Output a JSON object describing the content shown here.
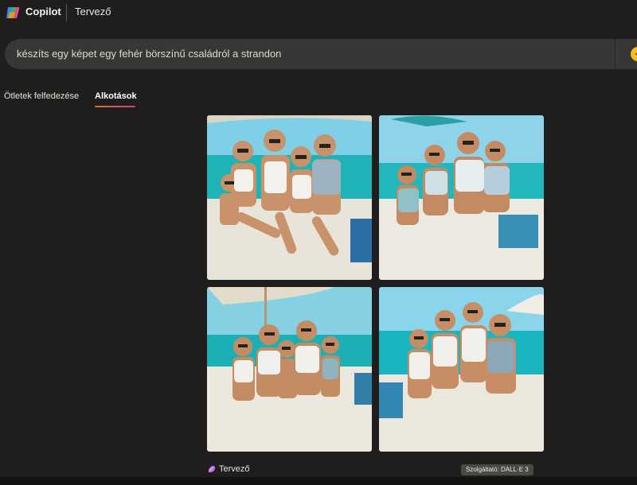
{
  "header": {
    "app_name": "Copilot",
    "product_name": "Tervező",
    "logo_icon": "copilot-logo-icon"
  },
  "prompt": {
    "text": "készíts egy képet egy fehér börszínű családról a strandon",
    "submit_icon": "create-sparkle-icon"
  },
  "tabs": [
    {
      "label": "Ötletek felfedezése",
      "active": false
    },
    {
      "label": "Alkotások",
      "active": true
    }
  ],
  "gallery": {
    "images": [
      {
        "subject": "family-beach-photo-1"
      },
      {
        "subject": "family-beach-photo-2"
      },
      {
        "subject": "family-beach-photo-3"
      },
      {
        "subject": "family-beach-photo-4"
      }
    ]
  },
  "footer": {
    "brand_label": "Tervező",
    "provider_label": "Szolgáltató: DALL·E 3"
  },
  "colors": {
    "background": "#1f1e1d",
    "prompt_bar": "#383735",
    "accent_gradient_start": "#e0702c",
    "accent_gradient_end": "#c8409a",
    "create_button": "#f4c01e"
  }
}
